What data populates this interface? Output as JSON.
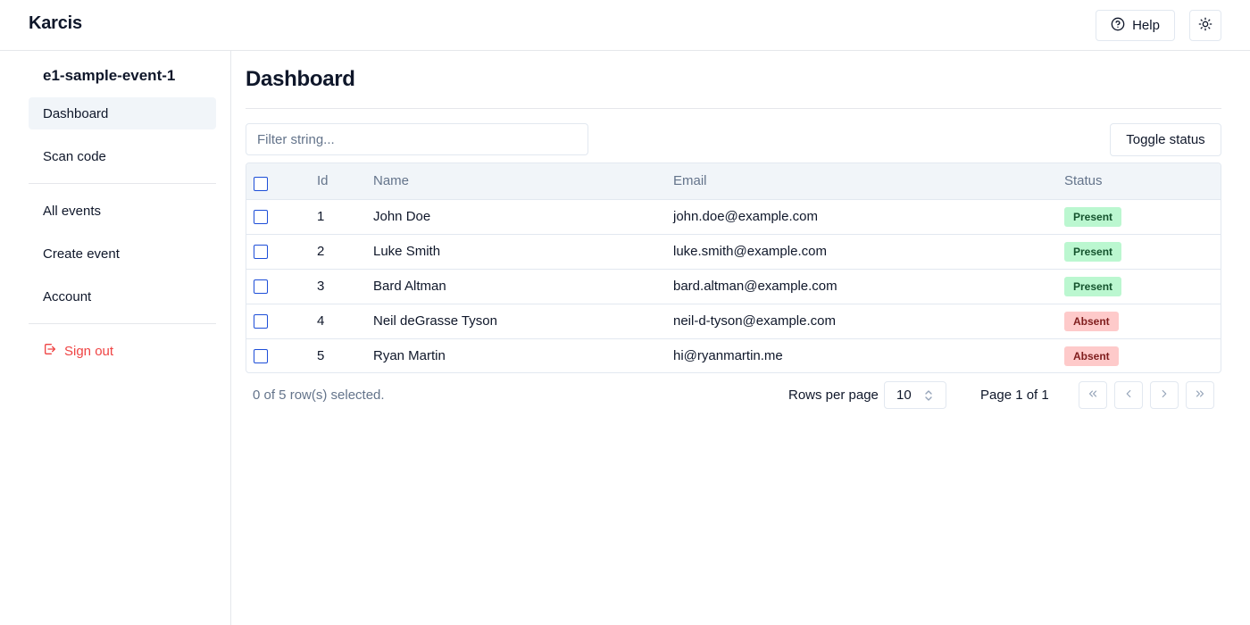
{
  "app": {
    "brand": "Karcis"
  },
  "header": {
    "help_label": "Help"
  },
  "sidebar": {
    "event_name": "e1-sample-event-1",
    "primary_items": [
      {
        "label": "Dashboard",
        "active": true
      },
      {
        "label": "Scan code"
      }
    ],
    "secondary_items": [
      {
        "label": "All events"
      },
      {
        "label": "Create event"
      },
      {
        "label": "Account"
      }
    ],
    "signout_label": "Sign out"
  },
  "main": {
    "title": "Dashboard",
    "filter_placeholder": "Filter string...",
    "toggle_status_label": "Toggle status",
    "table": {
      "columns": [
        "Id",
        "Name",
        "Email",
        "Status"
      ],
      "rows": [
        {
          "id": "1",
          "name": "John Doe",
          "email": "john.doe@example.com",
          "status": "Present"
        },
        {
          "id": "2",
          "name": "Luke Smith",
          "email": "luke.smith@example.com",
          "status": "Present"
        },
        {
          "id": "3",
          "name": "Bard Altman",
          "email": "bard.altman@example.com",
          "status": "Present"
        },
        {
          "id": "4",
          "name": "Neil deGrasse Tyson",
          "email": "neil-d-tyson@example.com",
          "status": "Absent"
        },
        {
          "id": "5",
          "name": "Ryan Martin",
          "email": "hi@ryanmartin.me",
          "status": "Absent"
        }
      ]
    },
    "footer": {
      "selected_text": "0 of 5 row(s) selected.",
      "rows_per_page_label": "Rows per page",
      "rows_per_page_value": "10",
      "page_label": "Page 1 of 1"
    }
  },
  "colors": {
    "present_bg": "#bbf7d0",
    "absent_bg": "#fecaca",
    "signout": "#ef4444",
    "checkbox": "#1d4ed8"
  }
}
